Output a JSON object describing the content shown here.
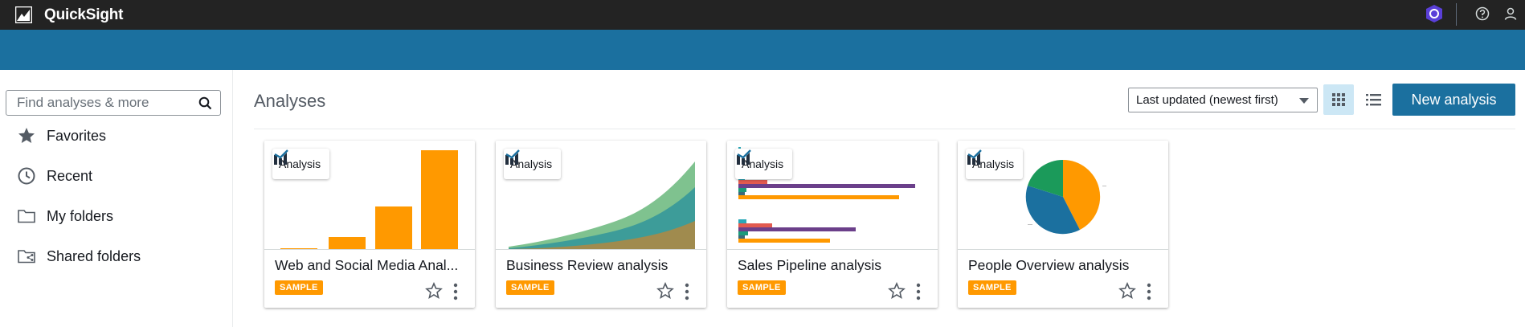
{
  "app": {
    "title": "QuickSight",
    "logo_icon": "quicksight-logo-icon",
    "colors": {
      "topbar": "#232323",
      "bluebar": "#1b709f",
      "accent": "#1b709f",
      "sample_badge": "#ff9900"
    }
  },
  "header_icons": [
    "shield-badge-icon",
    "help-icon",
    "user-icon"
  ],
  "sidebar": {
    "search": {
      "placeholder": "Find analyses & more",
      "value": ""
    },
    "items": [
      {
        "label": "Favorites",
        "icon": "star-icon"
      },
      {
        "label": "Recent",
        "icon": "clock-icon"
      },
      {
        "label": "My folders",
        "icon": "folder-icon"
      },
      {
        "label": "Shared folders",
        "icon": "shared-folder-icon"
      }
    ]
  },
  "main": {
    "title": "Analyses",
    "sort": {
      "selected": "Last updated (newest first)"
    },
    "view_buttons": [
      "grid-view-icon",
      "list-view-icon"
    ],
    "new_button_label": "New analysis",
    "cards": [
      {
        "chip_label": "Analysis",
        "title": "Web and Social Media Anal...",
        "badge": "SAMPLE",
        "thumbnail": "bar-chart"
      },
      {
        "chip_label": "Analysis",
        "title": "Business Review analysis",
        "badge": "SAMPLE",
        "thumbnail": "area-chart"
      },
      {
        "chip_label": "Analysis",
        "title": "Sales Pipeline analysis",
        "badge": "SAMPLE",
        "thumbnail": "horizontal-bar-chart"
      },
      {
        "chip_label": "Analysis",
        "title": "People Overview analysis",
        "badge": "SAMPLE",
        "thumbnail": "pie-chart"
      }
    ]
  }
}
